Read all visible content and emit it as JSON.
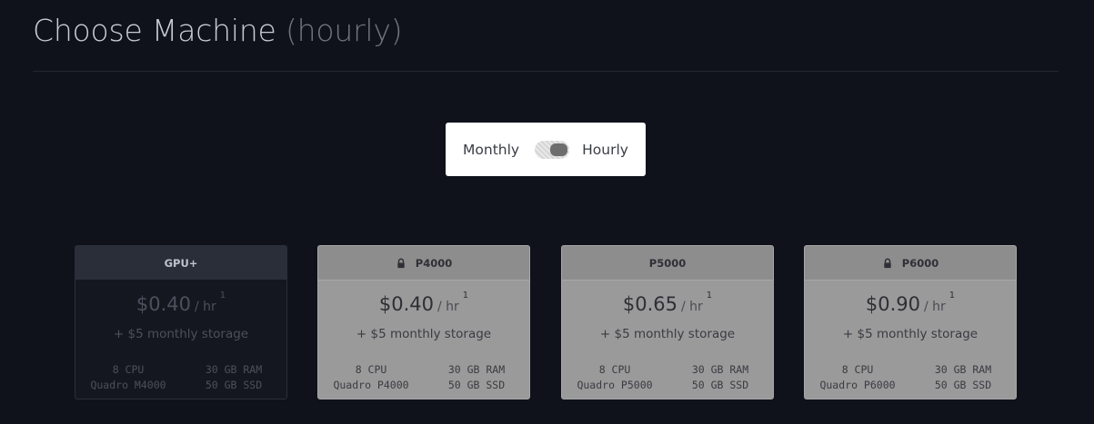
{
  "header": {
    "title": "Choose Machine",
    "subtitle": "(hourly)"
  },
  "billing_toggle": {
    "left_label": "Monthly",
    "right_label": "Hourly",
    "selected": "Hourly"
  },
  "machines": [
    {
      "name": "GPU+",
      "locked": false,
      "price": "$0.40",
      "unit": "/ hr",
      "footnote": "1",
      "storage": "+ $5 monthly storage",
      "cpu": "8 CPU",
      "ram": "30 GB RAM",
      "gpu": "Quadro M4000",
      "ssd": "50 GB SSD"
    },
    {
      "name": "P4000",
      "locked": true,
      "price": "$0.40",
      "unit": "/ hr",
      "footnote": "1",
      "storage": "+ $5 monthly storage",
      "cpu": "8 CPU",
      "ram": "30 GB RAM",
      "gpu": "Quadro P4000",
      "ssd": "50 GB SSD"
    },
    {
      "name": "P5000",
      "locked": false,
      "price": "$0.65",
      "unit": "/ hr",
      "footnote": "1",
      "storage": "+ $5 monthly storage",
      "cpu": "8 CPU",
      "ram": "30 GB RAM",
      "gpu": "Quadro P5000",
      "ssd": "50 GB SSD"
    },
    {
      "name": "P6000",
      "locked": true,
      "price": "$0.90",
      "unit": "/ hr",
      "footnote": "1",
      "storage": "+ $5 monthly storage",
      "cpu": "8 CPU",
      "ram": "30 GB RAM",
      "gpu": "Quadro P6000",
      "ssd": "50 GB SSD"
    }
  ],
  "colors": {
    "background": "#0f121b",
    "selected_card": "#14171f",
    "disabled_card": "#9a9a9b",
    "toggle_bg": "#ffffff"
  }
}
